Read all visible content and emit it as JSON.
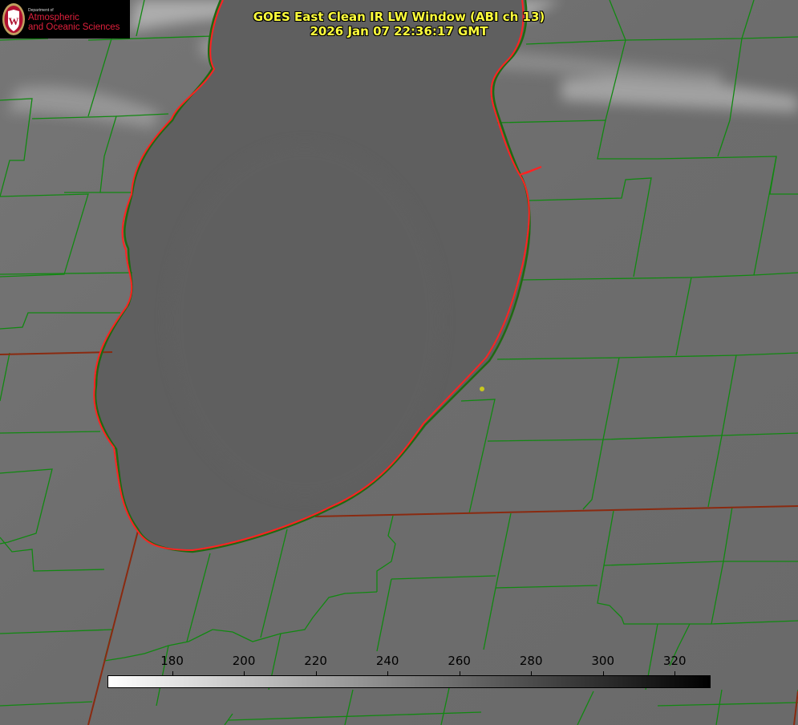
{
  "header": {
    "title_line1": "GOES East Clean IR LW Window (ABI ch 13)",
    "title_line2": "2026 Jan 07 22:36:17 GMT",
    "title_color": "#ffff3c"
  },
  "logo": {
    "dept_text": "Department of",
    "line1": "Atmospheric",
    "line2": "and Oceanic Sciences",
    "seal_letter": "W",
    "seal_icon": "uw-crest-icon",
    "text_color": "#e0203c"
  },
  "colorbar": {
    "ticks": [
      "180",
      "200",
      "220",
      "240",
      "260",
      "280",
      "300",
      "320"
    ],
    "tick_values": [
      180,
      200,
      220,
      240,
      260,
      280,
      300,
      320
    ],
    "min_value": 162,
    "max_value": 330,
    "color_low": "#ffffff",
    "color_high": "#000000"
  },
  "map": {
    "background_color": "#6e6e6e",
    "lake_color": "#5f5f5f",
    "county_line_color": "#118811",
    "coastline_color": "#ff2a2a",
    "marker_color": "#c8c81e"
  }
}
